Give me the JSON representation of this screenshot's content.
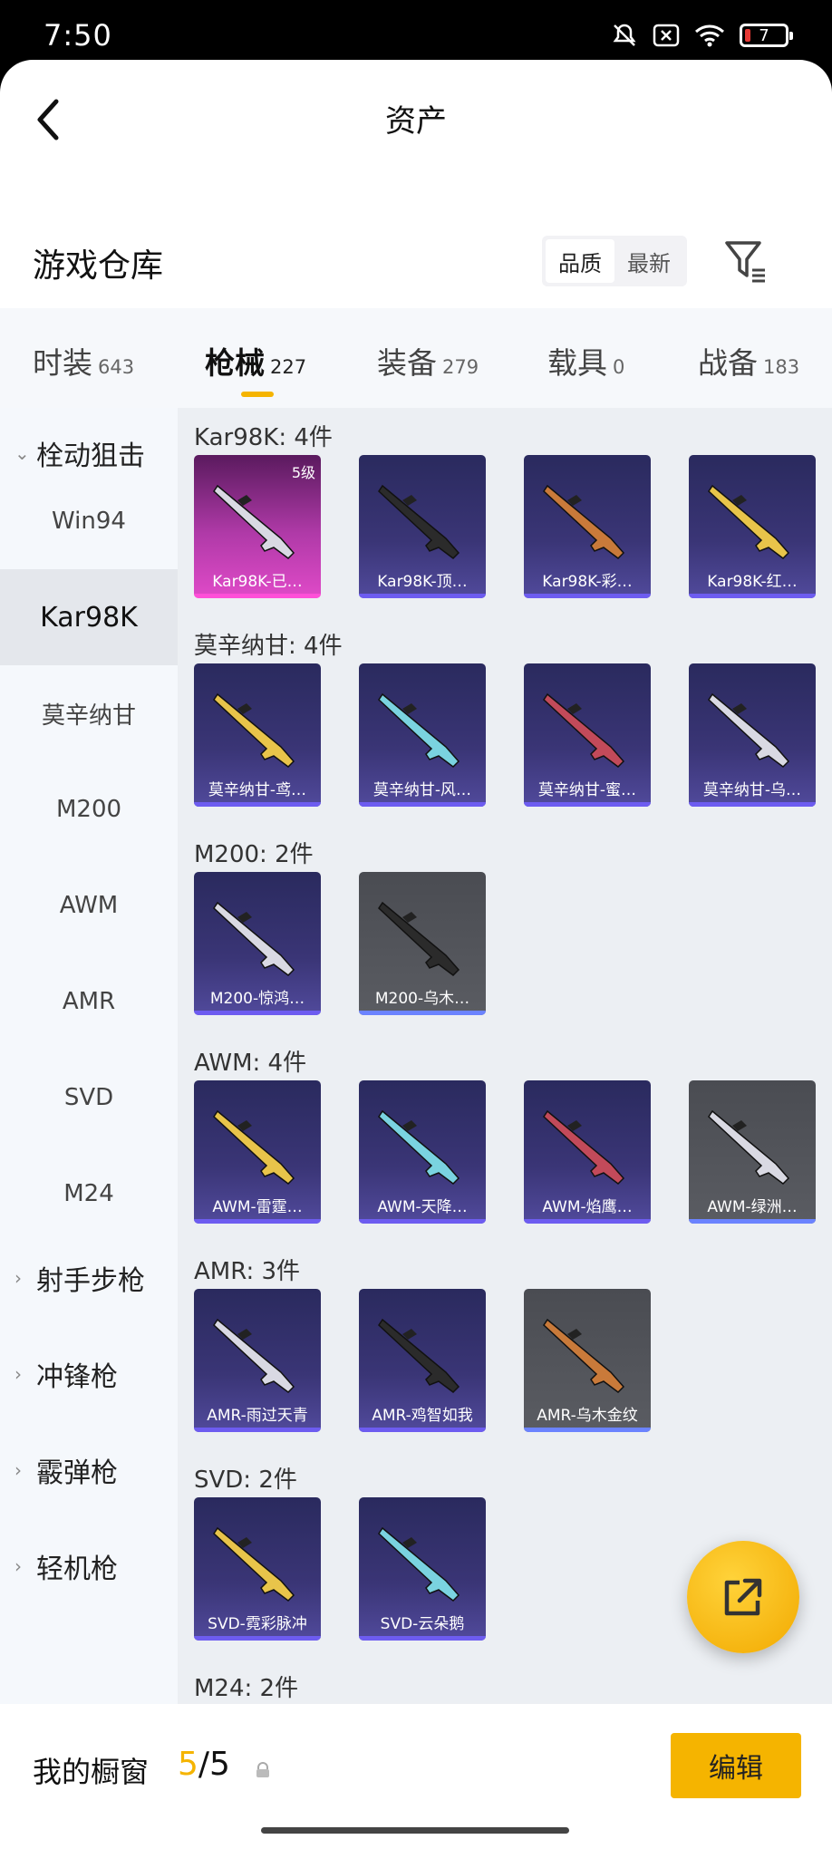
{
  "status": {
    "time": "7:50",
    "battery": "7"
  },
  "header": {
    "title": "资产"
  },
  "warehouse": {
    "title": "游戏仓库",
    "sort_options": [
      "品质",
      "最新"
    ],
    "active_sort": "品质"
  },
  "tabs": [
    {
      "label": "时装",
      "count": "643"
    },
    {
      "label": "枪械",
      "count": "227",
      "active": true
    },
    {
      "label": "装备",
      "count": "279"
    },
    {
      "label": "载具",
      "count": "0"
    },
    {
      "label": "战备",
      "count": "183"
    }
  ],
  "sidebar": {
    "category_open": "栓动狙击",
    "subitems": [
      "Win94",
      "Kar98K",
      "莫辛纳甘",
      "M200",
      "AWM",
      "AMR",
      "SVD",
      "M24"
    ],
    "active_subitem": "Kar98K",
    "other_categories": [
      "射手步枪",
      "冲锋枪",
      "霰弹枪",
      "轻机枪"
    ]
  },
  "groups": [
    {
      "header": "Kar98K: 4件",
      "items": [
        {
          "name": "Kar98K-已…",
          "level": "5级",
          "style": "pink"
        },
        {
          "name": "Kar98K-顶…",
          "style": "purple"
        },
        {
          "name": "Kar98K-彩…",
          "style": "purple"
        },
        {
          "name": "Kar98K-红…",
          "style": "purple"
        }
      ]
    },
    {
      "header": "莫辛纳甘: 4件",
      "items": [
        {
          "name": "莫辛纳甘-鸢…",
          "style": "purple"
        },
        {
          "name": "莫辛纳甘-风…",
          "style": "purple"
        },
        {
          "name": "莫辛纳甘-蜜…",
          "style": "purple"
        },
        {
          "name": "莫辛纳甘-乌…",
          "style": "purple"
        }
      ]
    },
    {
      "header": "M200: 2件",
      "items": [
        {
          "name": "M200-惊鸿…",
          "style": "purple"
        },
        {
          "name": "M200-乌木…",
          "style": "gray"
        }
      ]
    },
    {
      "header": "AWM: 4件",
      "items": [
        {
          "name": "AWM-雷霆…",
          "style": "purple"
        },
        {
          "name": "AWM-天降…",
          "style": "purple"
        },
        {
          "name": "AWM-焰鹰…",
          "style": "purple"
        },
        {
          "name": "AWM-绿洲…",
          "style": "gray"
        }
      ]
    },
    {
      "header": "AMR: 3件",
      "items": [
        {
          "name": "AMR-雨过天青",
          "style": "purple"
        },
        {
          "name": "AMR-鸡智如我",
          "style": "purple"
        },
        {
          "name": "AMR-乌木金纹",
          "style": "gray"
        }
      ]
    },
    {
      "header": "SVD: 2件",
      "items": [
        {
          "name": "SVD-霓彩脉冲",
          "style": "purple"
        },
        {
          "name": "SVD-云朵鹅",
          "style": "purple"
        }
      ]
    },
    {
      "header": "M24: 2件",
      "items": []
    }
  ],
  "bottom": {
    "title": "我的橱窗",
    "current": "5",
    "total": "/5",
    "edit_label": "编辑"
  },
  "colors": {
    "accent": "#f5b400",
    "card_purple": "#3a3576",
    "card_gray": "#55575d",
    "card_pink": "#b03aa8"
  }
}
